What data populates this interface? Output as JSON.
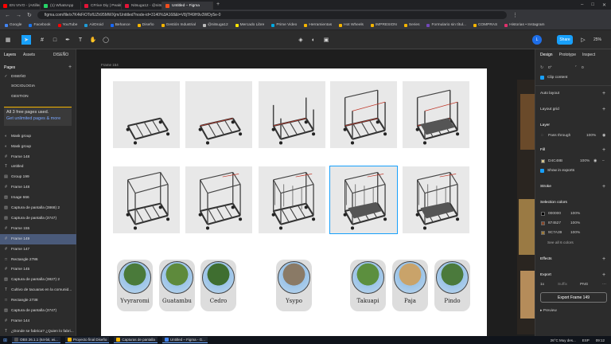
{
  "browser": {
    "tabs": [
      {
        "label": "EN VIVO - (Artillery HOT",
        "color": "#ff0000"
      },
      {
        "label": "(1) WhatsApp",
        "color": "#25d366"
      },
      {
        "label": "CFrive Diy | PeakD",
        "color": "#e31337"
      },
      {
        "label": "Nitsuga12 - @nitsuga12 | PeakD",
        "color": "#e31337"
      },
      {
        "label": "Untitled – Figma",
        "color": "#f24e1e",
        "active": true
      }
    ],
    "url": "figma.com/file/x7K4kFiOTofUZh95MWXjm/Untitled?node-id=3140%3A168&t=V8jTf49H9v3WDy5e-0",
    "bookmarks": [
      {
        "label": "Google",
        "color": "#4285f4"
      },
      {
        "label": "Facebook",
        "color": "#1877f2"
      },
      {
        "label": "YouTube",
        "color": "#ff0000"
      },
      {
        "label": "AirDroid",
        "color": "#1f9bd7"
      },
      {
        "label": "Behance",
        "color": "#1769ff"
      },
      {
        "label": "Diseño",
        "color": "#f4b400"
      },
      {
        "label": "Gestión Industrial",
        "color": "#f4b400"
      },
      {
        "label": "@nitsuga12",
        "color": "#bbbbbb"
      },
      {
        "label": "Mercado Libre",
        "color": "#ffe600"
      },
      {
        "label": "Prime Video",
        "color": "#00a8e1"
      },
      {
        "label": "Herramientas",
        "color": "#f4b400"
      },
      {
        "label": "Hot Wheels",
        "color": "#f4b400"
      },
      {
        "label": "IMPRESION",
        "color": "#f4b400"
      },
      {
        "label": "Series",
        "color": "#f4b400"
      },
      {
        "label": "Formulario sin títul...",
        "color": "#7248b9"
      },
      {
        "label": "COMPRAS",
        "color": "#f4b400"
      },
      {
        "label": "Historias • Instagram",
        "color": "#e1306c"
      }
    ]
  },
  "figma": {
    "left_tabs": [
      "Layers",
      "Assets",
      "DISEÑO"
    ],
    "pages_title": "Pages",
    "pages": [
      "DISEÑO",
      "SOCIOLOGIA",
      "GESTION"
    ],
    "plan_notice": "All 3 free pages used.",
    "plan_link": "Get unlimited pages & more",
    "layers": [
      "Mask group",
      "Mask group",
      "Frame 148",
      "untitled",
      "Group 199",
      "Frame 148",
      "Image 666",
      "Captura de pantalla (3868) 2",
      "Captura de pantalla (3747)",
      "Frame 155",
      "Frame 149",
      "Frame 147",
      "Rectangle 2786",
      "Frame 145",
      "Captura de pantalla (3827) 2",
      "Cultivo de tacuaras en la comunid...",
      "Rectangle 2738",
      "Captura de pantalla (3747)",
      "Frame 144",
      "¿Donde se fabrica? ¿Quien lo fabri..."
    ],
    "selected_layer_index": 10,
    "share_label": "Share",
    "zoom": "25%",
    "user_initial": "L",
    "frame_label": "Frame 154",
    "right_tabs": [
      "Design",
      "Prototype",
      "Inspect"
    ],
    "rotation": "0°",
    "corner_radius": "0",
    "clip_content": "Clip content",
    "auto_layout": "Auto layout",
    "layout_grid": "Layout grid",
    "layer_section": "Layer",
    "blend": "Pass through",
    "opacity": "100%",
    "fill_section": "Fill",
    "fill_hex": "D4C48B",
    "fill_opacity": "100%",
    "show_in_exports": "Show in exports",
    "stroke_section": "Stroke",
    "selection_colors_title": "Selection colors",
    "selection_colors": [
      {
        "hex": "000000",
        "opacity": "100%",
        "swatch": "#000000"
      },
      {
        "hex": "874527",
        "opacity": "100%",
        "swatch": "#874527"
      },
      {
        "hex": "9C7A39",
        "opacity": "100%",
        "swatch": "#9c7a39"
      }
    ],
    "see_all": "See all 6 colors",
    "effects_section": "Effects",
    "export_section": "Export",
    "export_scale": "1x",
    "export_suffix": "Suffix",
    "export_format": "PNG",
    "export_button": "Export Frame 149",
    "preview": "Preview"
  },
  "wood_cards": [
    {
      "name": "Yvyraromi",
      "color": "#4a7a3a"
    },
    {
      "name": "Guatambu",
      "color": "#5e8a3c"
    },
    {
      "name": "Cedro",
      "color": "#3f6e30"
    },
    {
      "name": "Ysypo",
      "color": "#8a7a66"
    },
    {
      "name": "Takuapi",
      "color": "#5c8f3e"
    },
    {
      "name": "Paja",
      "color": "#c9a36a"
    },
    {
      "name": "Pindo",
      "color": "#4b7a3c"
    }
  ],
  "taskbar": {
    "items": [
      "OBS 26.1.1 (64-bit, wi...",
      "Proyecto final Diseño",
      "Capturas de pantalla",
      "Untitled – Figma - G..."
    ],
    "weather": "26°C Muy des...",
    "lang": "ESP",
    "time": "09:12"
  }
}
